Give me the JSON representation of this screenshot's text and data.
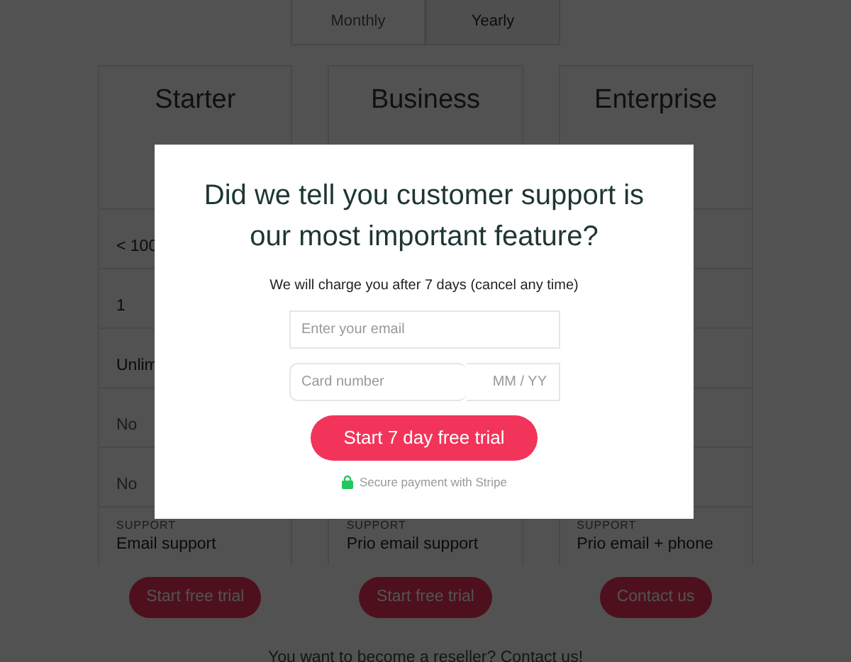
{
  "billing_toggle": [
    {
      "label": "Monthly",
      "selected": false
    },
    {
      "label": "Yearly",
      "selected": true
    }
  ],
  "plans": [
    {
      "name": "Starter",
      "rows": [
        {
          "value": "< 100",
          "muted": false
        },
        {
          "value": "1",
          "muted": false
        },
        {
          "value": "Unlim",
          "muted": false
        },
        {
          "value": "No",
          "muted": true
        },
        {
          "value": "No",
          "muted": true
        },
        {
          "label": "SUPPORT",
          "value": "Email support",
          "muted": false
        }
      ],
      "button": "Start free trial"
    },
    {
      "name": "Business",
      "rows": [
        {
          "label": "SUPPORT",
          "value": "Prio email support",
          "muted": false
        }
      ],
      "button": "Start free trial"
    },
    {
      "name": "Enterprise",
      "rows": [
        {
          "label": "SUPPORT",
          "value": "Prio email + phone",
          "muted": false
        }
      ],
      "button": "Contact us"
    }
  ],
  "reseller": {
    "text": "You want to become a reseller?",
    "link": "Contact us!"
  },
  "modal": {
    "title": "Did we tell you customer support is our most important feature?",
    "subtitle": "We will charge you after 7 days (cancel any time)",
    "email": {
      "placeholder": "Enter your email"
    },
    "card": {
      "placeholder": "Card number",
      "expiry_placeholder": "MM / YY"
    },
    "button": "Start 7 day free trial",
    "secure_note": "Secure payment with Stripe"
  }
}
